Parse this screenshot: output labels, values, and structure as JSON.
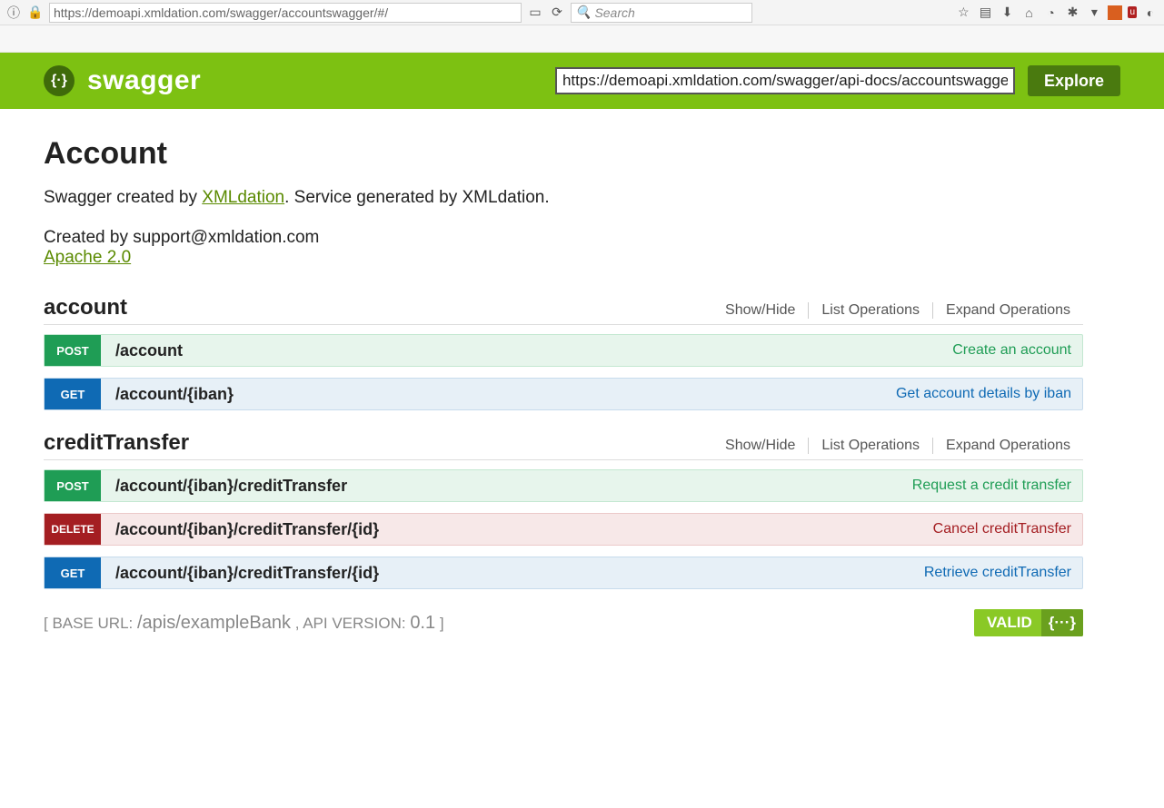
{
  "browser": {
    "url_display": "https://demoapi.xmldation.com/swagger/accountswagger/#/",
    "search_placeholder": "Search"
  },
  "header": {
    "brand": "swagger",
    "spec_url": "https://demoapi.xmldation.com/swagger/api-docs/accountswagger",
    "explore_label": "Explore"
  },
  "api": {
    "title": "Account",
    "desc_prefix": "Swagger created by ",
    "desc_link": "XMLdation",
    "desc_suffix": ". Service generated by XMLdation.",
    "created_by": "Created by support@xmldation.com",
    "license": "Apache 2.0"
  },
  "resources": [
    {
      "name": "account",
      "actions": {
        "showhide": "Show/Hide",
        "list": "List Operations",
        "expand": "Expand Operations"
      },
      "ops": [
        {
          "method": "POST",
          "cls": "post",
          "path": "/account",
          "summary": "Create an account"
        },
        {
          "method": "GET",
          "cls": "get",
          "path": "/account/{iban}",
          "summary": "Get account details by iban"
        }
      ]
    },
    {
      "name": "creditTransfer",
      "actions": {
        "showhide": "Show/Hide",
        "list": "List Operations",
        "expand": "Expand Operations"
      },
      "ops": [
        {
          "method": "POST",
          "cls": "post",
          "path": "/account/{iban}/creditTransfer",
          "summary": "Request a credit transfer"
        },
        {
          "method": "DELETE",
          "cls": "delete",
          "path": "/account/{iban}/creditTransfer/{id}",
          "summary": "Cancel creditTransfer"
        },
        {
          "method": "GET",
          "cls": "get",
          "path": "/account/{iban}/creditTransfer/{id}",
          "summary": "Retrieve creditTransfer"
        }
      ]
    }
  ],
  "footer": {
    "base_url_label": "BASE URL",
    "base_url": "/apis/exampleBank",
    "api_version_label": "API VERSION",
    "api_version": "0.1",
    "valid_label": "VALID",
    "braces": "{···}"
  }
}
